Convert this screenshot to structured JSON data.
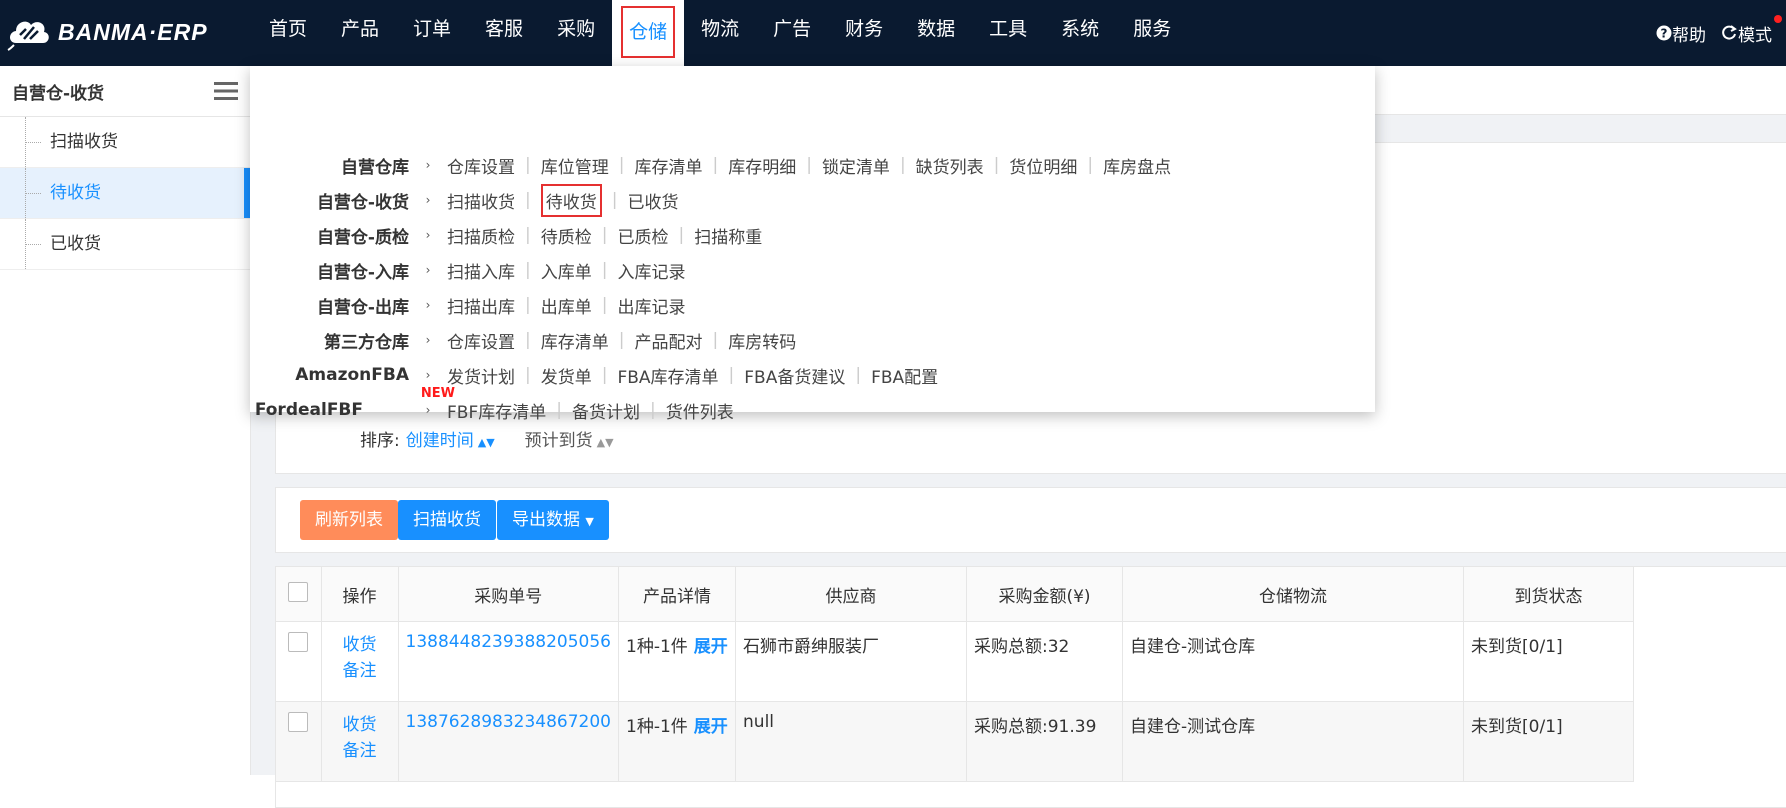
{
  "brand": {
    "name": "BANMA·ERP"
  },
  "nav": {
    "items": [
      "首页",
      "产品",
      "订单",
      "客服",
      "采购",
      "仓储",
      "物流",
      "广告",
      "财务",
      "数据",
      "工具",
      "系统",
      "服务"
    ],
    "active_index": 5
  },
  "topright": {
    "help": "帮助",
    "mode": "模式"
  },
  "sidebar": {
    "title": "自营仓-收货",
    "items": [
      {
        "label": "扫描收货",
        "active": false
      },
      {
        "label": "待收货",
        "active": true
      },
      {
        "label": "已收货",
        "active": false
      }
    ]
  },
  "dropdown": {
    "rows": [
      {
        "category": "自营仓库",
        "links": [
          "仓库设置",
          "库位管理",
          "库存清单",
          "库存明细",
          "锁定清单",
          "缺货列表",
          "货位明细",
          "库房盘点"
        ]
      },
      {
        "category": "自营仓-收货",
        "links": [
          "扫描收货",
          "待收货",
          "已收货"
        ],
        "highlight": 1
      },
      {
        "category": "自营仓-质检",
        "links": [
          "扫描质检",
          "待质检",
          "已质检",
          "扫描称重"
        ]
      },
      {
        "category": "自营仓-入库",
        "links": [
          "扫描入库",
          "入库单",
          "入库记录"
        ]
      },
      {
        "category": "自营仓-出库",
        "links": [
          "扫描出库",
          "出库单",
          "出库记录"
        ]
      },
      {
        "category": "第三方仓库",
        "links": [
          "仓库设置",
          "库存清单",
          "产品配对",
          "库房转码"
        ]
      },
      {
        "category": "AmazonFBA",
        "links": [
          "发货计划",
          "发货单",
          "FBA库存清单",
          "FBA备货建议",
          "FBA配置"
        ]
      },
      {
        "category": "FordealFBF",
        "badge": "NEW",
        "links": [
          "FBF库存清单",
          "备货计划",
          "货件列表"
        ]
      }
    ]
  },
  "sort": {
    "label": "排序:",
    "options": [
      "创建时间",
      "预计到货"
    ]
  },
  "actions": {
    "refresh": "刷新列表",
    "scan": "扫描收货",
    "export": "导出数据"
  },
  "table": {
    "columns": [
      "操作",
      "采购单号",
      "产品详情",
      "供应商",
      "采购金额(¥)",
      "仓储物流",
      "到货状态"
    ],
    "rows": [
      {
        "ops": [
          "收货",
          "备注"
        ],
        "po": "1388448239388205056",
        "detail": "1种-1件",
        "expand": "展开",
        "supplier": "石狮市爵绅服装厂",
        "amount": "采购总额:32",
        "warehouse": "自建仓-测试仓库",
        "status": "未到货[0/1]"
      },
      {
        "ops": [
          "收货",
          "备注"
        ],
        "po": "1387628983234867200",
        "detail": "1种-1件",
        "expand": "展开",
        "supplier": "null",
        "amount": "采购总额:91.39",
        "warehouse": "自建仓-测试仓库",
        "status": "未到货[0/1]"
      }
    ]
  }
}
